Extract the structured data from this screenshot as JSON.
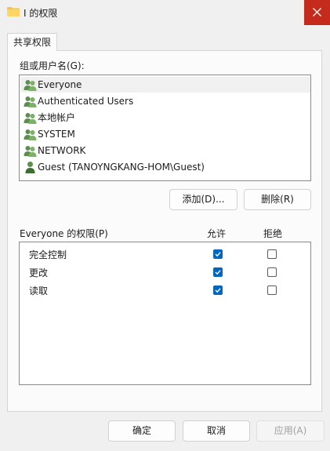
{
  "window": {
    "title": "I 的权限",
    "close_icon": "close-icon"
  },
  "tab": {
    "label": "共享权限"
  },
  "users_section": {
    "label": "组或用户名(G):",
    "users": [
      {
        "name": "Everyone",
        "icon": "group-icon",
        "selected": true
      },
      {
        "name": "Authenticated Users",
        "icon": "group-icon"
      },
      {
        "name": "本地帐户",
        "icon": "group-icon"
      },
      {
        "name": "SYSTEM",
        "icon": "group-icon"
      },
      {
        "name": "NETWORK",
        "icon": "group-icon"
      },
      {
        "name": "Guest (TANOYNGKANG-HOM\\Guest)",
        "icon": "user-icon"
      }
    ],
    "add_button": "添加(D)...",
    "remove_button": "删除(R)"
  },
  "permissions": {
    "label": "Everyone 的权限(P)",
    "allow_header": "允许",
    "deny_header": "拒绝",
    "rows": [
      {
        "name": "完全控制",
        "allow": true,
        "deny": false
      },
      {
        "name": "更改",
        "allow": true,
        "deny": false
      },
      {
        "name": "读取",
        "allow": true,
        "deny": false
      }
    ]
  },
  "footer": {
    "ok": "确定",
    "cancel": "取消",
    "apply": "应用(A)"
  },
  "colors": {
    "accent": "#0067c0",
    "close_red": "#c42b1c"
  }
}
